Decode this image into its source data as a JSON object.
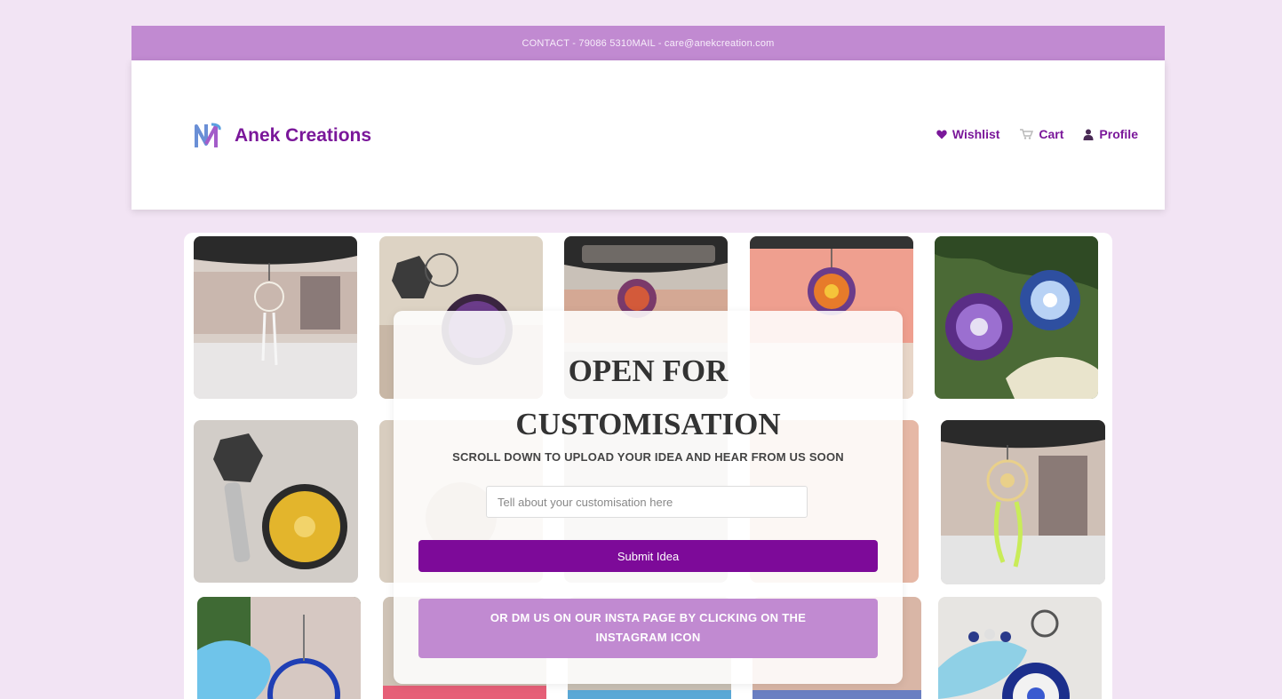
{
  "topbar": {
    "contact_text": "CONTACT - 79086 5310MAIL - care@anekcreation.com"
  },
  "header": {
    "brand": {
      "name": "Anek Creations",
      "logo_icon": "anek-logo-icon"
    },
    "nav": [
      {
        "label": "Wishlist",
        "icon": "heart-icon"
      },
      {
        "label": "Cart",
        "icon": "cart-icon"
      },
      {
        "label": "Profile",
        "icon": "user-icon"
      }
    ]
  },
  "customise": {
    "title_line1": "OPEN FOR",
    "title_line2": "CUSTOMISATION",
    "subtitle": "SCROLL DOWN TO UPLOAD YOUR IDEA AND HEAR FROM US SOON",
    "input_placeholder": "Tell about your customisation here",
    "input_value": "",
    "submit_label": "Submit Idea",
    "insta_line1": "OR DM US ON OUR INSTA PAGE BY CLICKING ON THE",
    "insta_line2": "INSTAGRAM ICON"
  },
  "colors": {
    "page_bg": "#f2e4f4",
    "topbar_bg": "#c18ad1",
    "brand_purple": "#7a179a",
    "submit_bg": "#7d0a99"
  }
}
